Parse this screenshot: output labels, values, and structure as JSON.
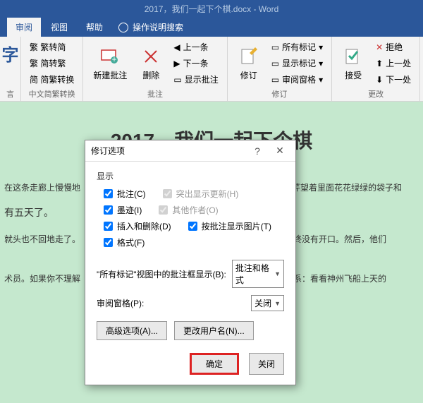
{
  "titlebar": "2017，我们一起下个棋.docx  -  Word",
  "tabs": {
    "review": "审阅",
    "view": "视图",
    "help": "帮助",
    "tellme": "操作说明搜索"
  },
  "ribbon": {
    "char_icon": "字",
    "simplified": {
      "toSimple": "繁 繁转简",
      "toTrad": "繁 简转繁",
      "convert": "简 简繁转换",
      "group": "中文简繁转换"
    },
    "comments": {
      "new": "新建批注",
      "delete": "删除",
      "prev": "上一条",
      "next": "下一条",
      "show": "显示批注",
      "group": "批注"
    },
    "tracking": {
      "track": "修订",
      "allmarkup": "所有标记",
      "showmarkup": "显示标记",
      "pane": "审阅窗格",
      "group": "修订"
    },
    "changes": {
      "accept": "接受",
      "reject": "拒绝",
      "prev": "上一处",
      "next": "下一处",
      "group": "更改"
    }
  },
  "doc": {
    "title": "2017，我们一起下个棋",
    "p1": "在这条走廊上慢慢地",
    "p1b": "芹望着里面花花绿绿的袋子和",
    "p2": "有五天了。",
    "p3": "就头也不回地走了。",
    "p3b": "最终没有开口。然后，他们",
    "p4": "术员。如果你不理解",
    "p4b": "关系：看看神州飞船上天的"
  },
  "dialog": {
    "title": "修订选项",
    "section": "显示",
    "chk": {
      "comments": "批注(C)",
      "highlight": "突出显示更新(H)",
      "ink": "墨迹(I)",
      "others": "其他作者(O)",
      "insdel": "插入和删除(D)",
      "pics": "按批注显示图片(T)",
      "format": "格式(F)"
    },
    "balloons_label": "\"所有标记\"视图中的批注框显示(B):",
    "balloons_value": "批注和格式",
    "pane_label": "审阅窗格(P):",
    "pane_value": "关闭",
    "advanced": "高级选项(A)...",
    "username": "更改用户名(N)...",
    "ok": "确定",
    "cancel": "关闭"
  }
}
